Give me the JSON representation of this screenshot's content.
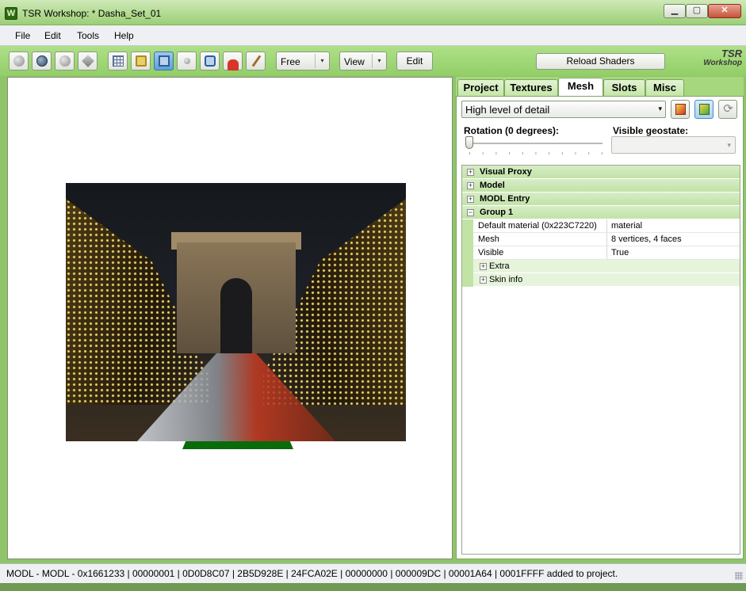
{
  "window": {
    "title": "TSR Workshop: * Dasha_Set_01",
    "app_icon": "W",
    "min_glyph": "▁",
    "max_glyph": "▢",
    "close_glyph": "✕"
  },
  "menu": {
    "items": [
      "File",
      "Edit",
      "Tools",
      "Help"
    ]
  },
  "toolbar": {
    "camera_mode": "Free",
    "view_label": "View",
    "edit_label": "Edit",
    "reload_label": "Reload Shaders",
    "logo_line1": "TSR",
    "logo_line2": "Workshop",
    "dropdown_arrow": "▾",
    "icons": [
      "shaded-sphere-icon",
      "dark-sphere-icon",
      "light-sphere-icon",
      "diamond-icon",
      "grid-icon",
      "bone-icon",
      "mesh-icon",
      "sphere-icon",
      "joint-icon",
      "pad-icon",
      "pen-icon"
    ]
  },
  "tabs": [
    "Project",
    "Textures",
    "Mesh",
    "Slots",
    "Misc"
  ],
  "active_tab": "Mesh",
  "mesh_panel": {
    "lod_value": "High level of detail",
    "rotation_label": "Rotation (0 degrees):",
    "rotation_degrees": 0,
    "geostate_label": "Visible geostate:",
    "geostate_value": "",
    "refresh_glyph": "⟳"
  },
  "properties": {
    "categories": [
      "Visual Proxy",
      "Model",
      "MODL Entry",
      "Group 1"
    ],
    "expand_glyph": "+",
    "collapse_glyph": "−",
    "group_rows": [
      {
        "key": "Default material (0x223C7220)",
        "value": "material"
      },
      {
        "key": "Mesh",
        "value": "8 vertices, 4 faces"
      },
      {
        "key": "Visible",
        "value": "True"
      }
    ],
    "subcategories": [
      "Extra",
      "Skin info"
    ]
  },
  "status": {
    "text": "MODL - MODL - 0x1661233 | 00000001 | 0D0D8C07 | 2B5D928E | 24FCA02E | 00000000 | 000009DC | 00001A64 | 0001FFFF added to project."
  },
  "colors": {
    "accent": "#9ccf78",
    "panel_green": "#a6d77f",
    "category_green": "#c2e3a6"
  }
}
